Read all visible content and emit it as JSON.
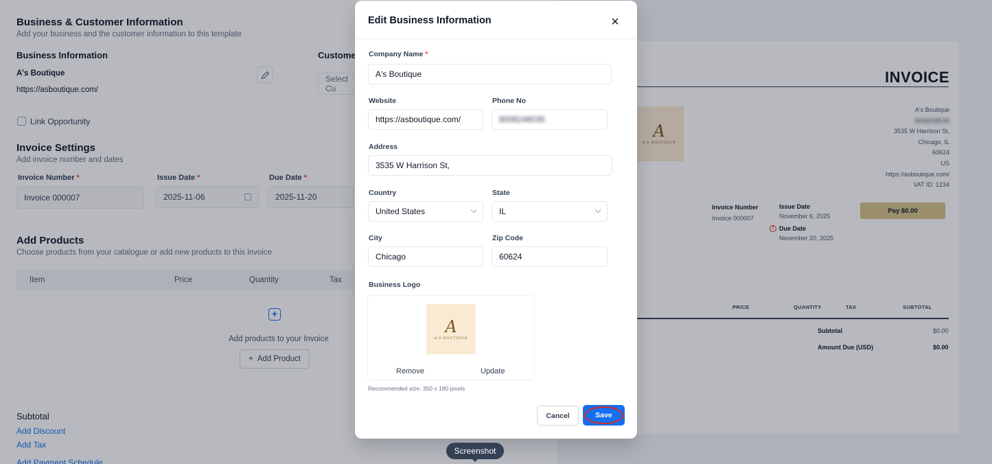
{
  "background": {
    "biz_section": {
      "title": "Business & Customer Information",
      "subtitle": "Add your business and the customer information to this template",
      "business_info_heading": "Business Information",
      "customer_heading": "Customer",
      "business_name": "A's Boutique",
      "business_url": "https://asboutique.com/",
      "customer_select_placeholder": "Select Cu",
      "link_opportunity": "Link Opportunity"
    },
    "invoice_settings": {
      "title": "Invoice Settings",
      "subtitle": "Add invoice number and dates",
      "number_label": "Invoice Number",
      "number_value": "Invoice 000007",
      "issue_label": "Issue Date",
      "issue_value": "2025-11-06",
      "due_label": "Due Date",
      "due_value": "2025-11-20"
    },
    "products": {
      "title": "Add Products",
      "subtitle": "Choose products from your catalogue or add new products to this invoice",
      "columns": [
        "Item",
        "Price",
        "Quantity",
        "Tax"
      ],
      "empty_text": "Add products to your Invoice",
      "add_button": "Add Product"
    },
    "totals": {
      "subtotal": "Subtotal",
      "add_discount": "Add Discount",
      "add_tax": "Add Tax",
      "add_payment_schedule": "Add Payment Schedule"
    }
  },
  "preview": {
    "title": "INVOICE",
    "logo_letter": "A",
    "logo_text": "A'S BOUTIQUE",
    "address_lines": [
      "A's Boutique",
      "8008248035",
      "3535 W Harrison St,",
      "Chicago, IL",
      "60624",
      "US",
      "https://asboutique.com/",
      "VAT ID: 1234"
    ],
    "invoice_number_label": "Invoice Number",
    "invoice_number_value": "Invoice 000007",
    "issue_date_label": "Issue Date",
    "issue_date_value": "November 6, 2025",
    "due_date_label": "Due Date",
    "due_date_value": "November 20, 2025",
    "pay_button": "Pay $0.00",
    "columns": [
      "PRICE",
      "QUANTITY",
      "TAX",
      "SUBTOTAL"
    ],
    "subtotal_label": "Subtotal",
    "subtotal_value": "$0.00",
    "amount_due_label": "Amount Due (USD)",
    "amount_due_value": "$0.00"
  },
  "modal": {
    "title": "Edit Business Information",
    "company_name_label": "Company Name",
    "company_name_value": "A's Boutique",
    "website_label": "Website",
    "website_value": "https://asboutique.com/",
    "phone_label": "Phone No",
    "phone_value": "8008248035",
    "address_label": "Address",
    "address_value": "3535 W Harrison St,",
    "country_label": "Country",
    "country_value": "United States",
    "state_label": "State",
    "state_value": "IL",
    "city_label": "City",
    "city_value": "Chicago",
    "zip_label": "Zip Code",
    "zip_value": "60624",
    "logo_label": "Business Logo",
    "logo_letter": "A",
    "logo_text": "A'S BOUTIQUE",
    "remove": "Remove",
    "update": "Update",
    "hint": "Recommended size: 350 x 180 pixels",
    "cancel": "Cancel",
    "save": "Save",
    "required_mark": "*"
  },
  "tooltip": "Screenshot"
}
